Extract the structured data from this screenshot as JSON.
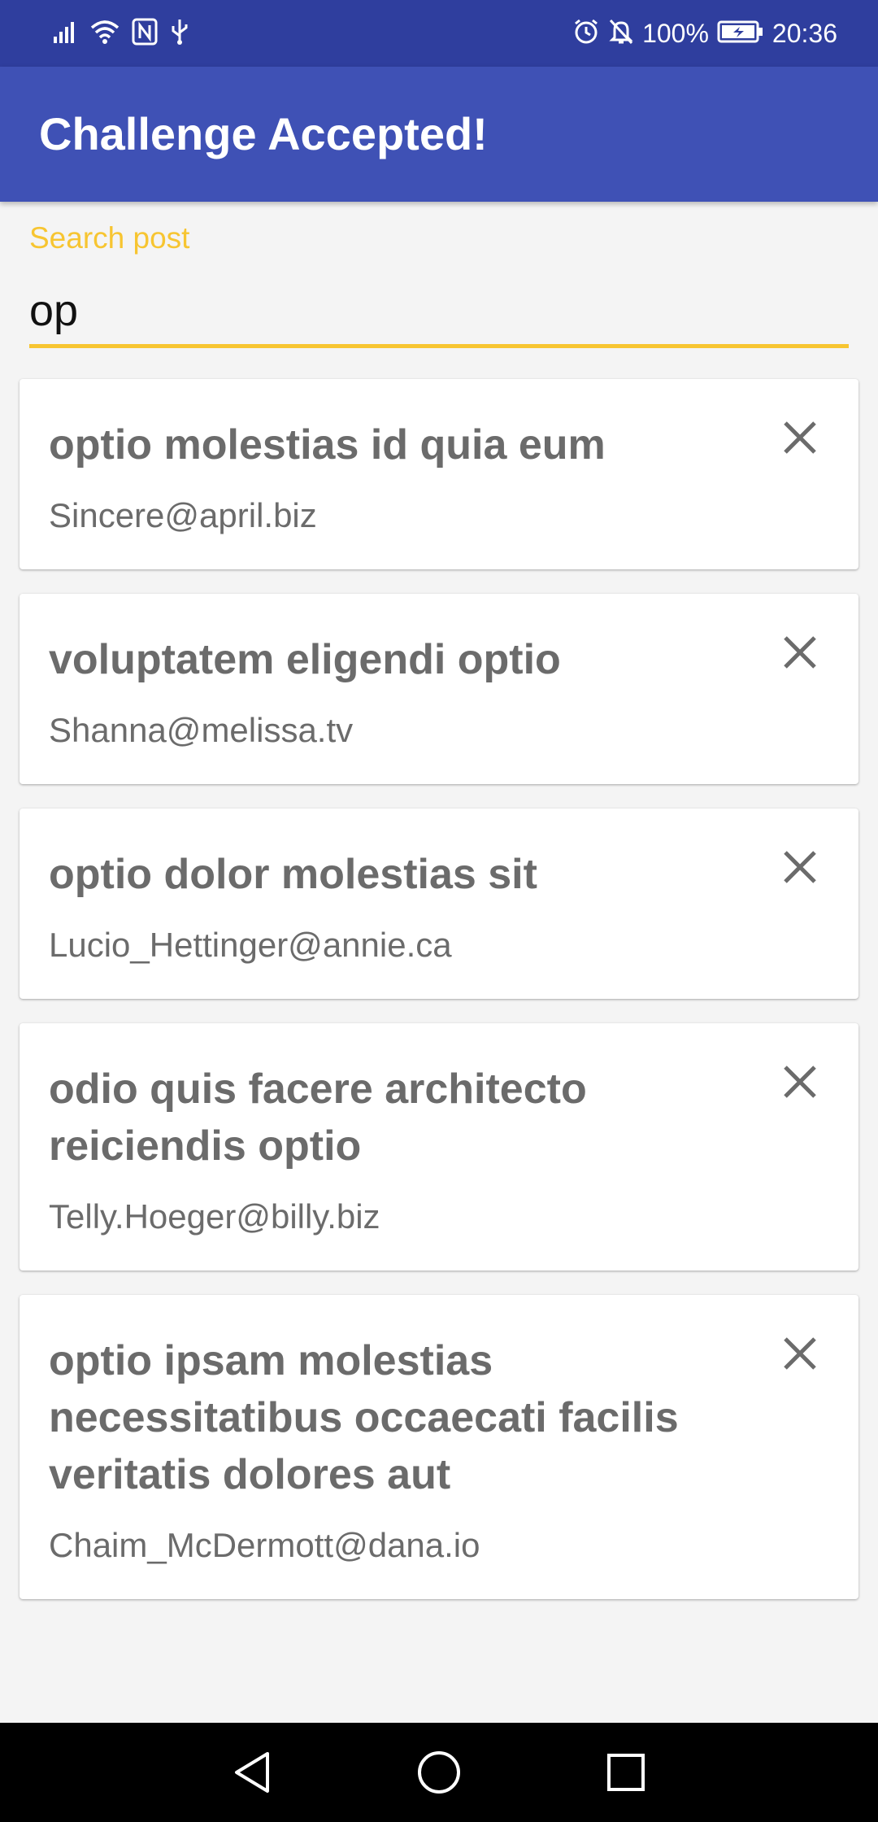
{
  "status_bar": {
    "battery_percent": "100%",
    "time": "20:36",
    "icons_left": [
      "signal-icon",
      "wifi-icon",
      "nfc-icon",
      "usb-icon"
    ],
    "icons_right": [
      "alarm-icon",
      "bell-off-icon",
      "battery-charging-icon"
    ]
  },
  "app_bar": {
    "title": "Challenge Accepted!"
  },
  "search": {
    "label": "Search post",
    "value": "op"
  },
  "posts": [
    {
      "title": "optio molestias id quia eum",
      "email": "Sincere@april.biz"
    },
    {
      "title": "voluptatem eligendi optio",
      "email": "Shanna@melissa.tv"
    },
    {
      "title": "optio dolor molestias sit",
      "email": "Lucio_Hettinger@annie.ca"
    },
    {
      "title": "odio quis facere architecto reiciendis optio",
      "email": "Telly.Hoeger@billy.biz"
    },
    {
      "title": "optio ipsam molestias necessitatibus occaecati facilis veritatis dolores aut",
      "email": "Chaim_McDermott@dana.io"
    }
  ],
  "nav_bar": {
    "buttons": [
      "back-icon",
      "home-icon",
      "recents-icon"
    ]
  },
  "colors": {
    "primary": "#3f51b5",
    "primary_dark": "#2f3e9e",
    "accent": "#f7c531"
  }
}
